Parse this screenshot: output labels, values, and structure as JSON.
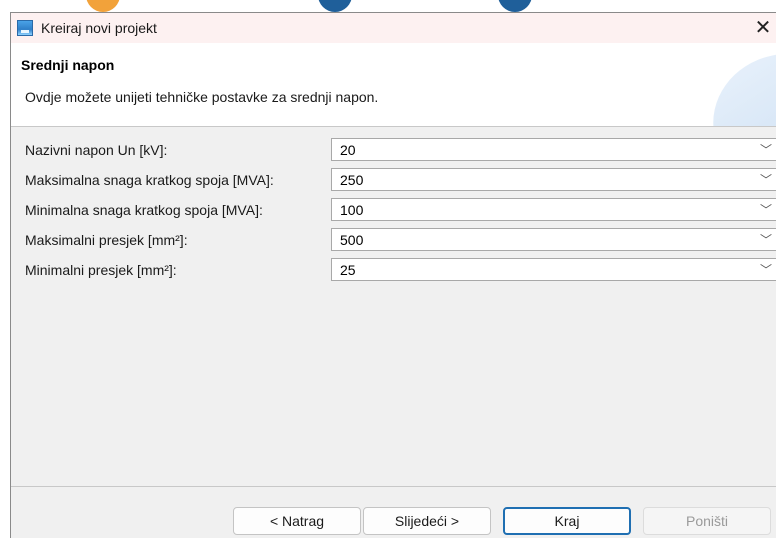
{
  "window": {
    "title": "Kreiraj novi projekt",
    "close_glyph": "✕"
  },
  "banner": {
    "heading": "Srednji napon",
    "description": "Ovdje možete unijeti tehničke postavke za srednji napon."
  },
  "fields": [
    {
      "label": "Nazivni napon Un [kV]:",
      "value": "20"
    },
    {
      "label": "Maksimalna snaga kratkog spoja [MVA]:",
      "value": "250"
    },
    {
      "label": "Minimalna snaga kratkog spoja [MVA]:",
      "value": "100"
    },
    {
      "label": "Maksimalni presjek [mm²]:",
      "value": "500"
    },
    {
      "label": "Minimalni presjek [mm²]:",
      "value": "25"
    }
  ],
  "buttons": {
    "back": "< Natrag",
    "next": "Slijedeći >",
    "finish": "Kraj",
    "cancel": "Poništi"
  },
  "icons": {
    "app": "app-window-icon",
    "dropdown": "chevron-down-icon",
    "close": "close-icon"
  }
}
